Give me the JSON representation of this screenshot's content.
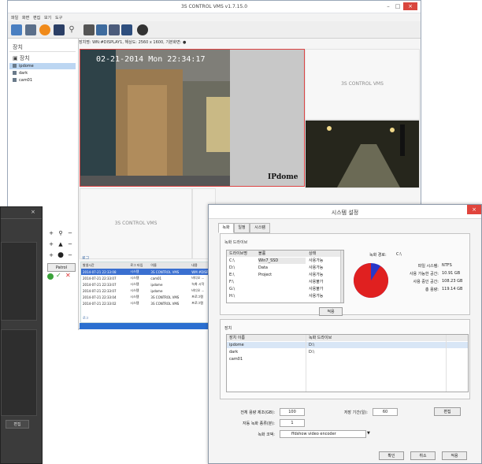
{
  "main_window": {
    "title": "3S CONTROL VMS v1.7.15.0",
    "menu": [
      "파일",
      "화면",
      "편집",
      "보기",
      "도구"
    ],
    "status_line": "장치명: WN:#DISPLAY1, 해상도: 2560 x 1600, 기본화면: ●",
    "device_panel": {
      "header": "장치",
      "root_label": "장치",
      "devices": [
        "ipdome",
        "dark",
        "cam01"
      ]
    },
    "video": {
      "timestamp": "02-21-2014 Mon 22:34:17",
      "camera_label": "IPdome",
      "placeholder": "3S CONTROL VMS"
    },
    "ptz": {
      "patrol_label": "Patrol"
    },
    "log": {
      "title": "로그",
      "tab": "로그",
      "columns": [
        "발생시간",
        "로그 타입",
        "이름",
        "내용"
      ],
      "rows": [
        [
          "2014-07-21 22:33:08",
          "시스템",
          "3S CONTROL VMS",
          "WM #DISPL"
        ],
        [
          "2014-07-21 22:33:07",
          "시스템",
          "cam01",
          "비디오 ..."
        ],
        [
          "2014-07-21 22:33:07",
          "시스템",
          "ipdome",
          "녹화 시작"
        ],
        [
          "2014-07-21 22:33:07",
          "시스템",
          "ipdome",
          "비디오 ..."
        ],
        [
          "2014-07-21 22:33:04",
          "시스템",
          "3S CONTROL VMS",
          "프로그램"
        ],
        [
          "2014-07-21 22:33:02",
          "시스템",
          "3S CONTROL VMS",
          "프로그램"
        ]
      ]
    }
  },
  "dark_window": {
    "edit_button": "편집"
  },
  "dialog": {
    "title": "시스템 설정",
    "tabs": [
      "녹화",
      "일정",
      "시스템"
    ],
    "drive_group": {
      "label": "녹화 드라이브",
      "columns": [
        "드라이브명",
        "볼륨",
        "상태"
      ],
      "rows": [
        [
          "C:\\",
          "Win7_SSD",
          "사용가능"
        ],
        [
          "D:\\",
          "Data",
          "사용가능"
        ],
        [
          "E:\\",
          "Project",
          "사용가능"
        ],
        [
          "F:\\",
          "",
          "사용불가"
        ],
        [
          "G:\\",
          "",
          "사용불가"
        ],
        [
          "H:\\",
          "",
          "사용가능"
        ]
      ],
      "apply_button": "적용",
      "record_path_label": "녹화 경로:",
      "record_path_value": "C:\\",
      "fs_label": "파일 시스템:",
      "fs_value": "NTFS",
      "free_label": "사용 가능한 공간:",
      "free_value": "10.91 GB",
      "used_label": "사용 중인 공간:",
      "used_value": "108.23 GB",
      "total_label": "총 용량:",
      "total_value": "119.14 GB",
      "used_fraction": 0.908,
      "used_color": "#e02020",
      "free_color": "#2838c8"
    },
    "device_group": {
      "label": "장치",
      "columns": [
        "장치 이름",
        "녹화 드라이브"
      ],
      "rows": [
        [
          "ipdome",
          "D:\\"
        ],
        [
          "dark",
          "D:\\"
        ],
        [
          "cam01",
          ""
        ]
      ]
    },
    "full_disk_label": "전체 용량 제조(GB):",
    "full_disk_value": "100",
    "retention_label": "저장 기간(일):",
    "retention_value": "60",
    "auto_delete_label": "자동 녹화 종류(분):",
    "auto_delete_value": "1",
    "codec_label": "녹화 코덱:",
    "codec_value": "ffdshow video encoder",
    "edit_button": "편집",
    "ok_button": "확인",
    "cancel_button": "취소",
    "apply_button": "적용"
  }
}
